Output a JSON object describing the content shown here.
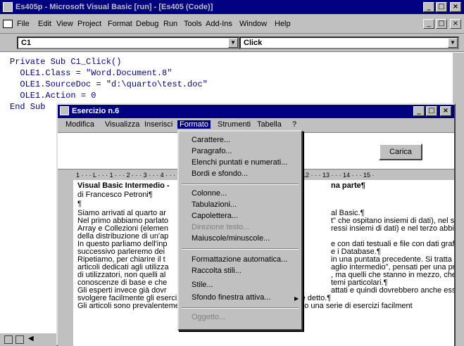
{
  "vb": {
    "title": "Es405p - Microsoft Visual Basic [run] - [Es405 (Code)]",
    "menu": [
      "File",
      "Edit",
      "View",
      "Project",
      "Format",
      "Debug",
      "Run",
      "Tools",
      "Add-Ins",
      "Window",
      "Help"
    ],
    "object_combo": "C1",
    "proc_combo": "Click",
    "code": [
      "Private Sub C1_Click()",
      "  OLE1.Class = \"Word.Document.8\"",
      "  OLE1.SourceDoc = \"d:\\quarto\\test.doc\"",
      "  OLE1.Action = 0",
      "End Sub"
    ]
  },
  "esercizio": {
    "title": "Esercizio n.6",
    "menu": [
      "Modifica",
      "Visualizza",
      "Inserisci",
      "Formato",
      "Strumenti",
      "Tabella",
      "?"
    ],
    "active_menu": "Formato",
    "carica_button": "Carica",
    "ruler": "1 · · · L · · · 1 · · · 2 · · · 3 · · · 4 · · · 5 · · · 6 · · · 7 · · · 8 · · · 9 · · · 10 · · · 11 · · · 12 · · · 13 · · · 14 · · · 15 ·"
  },
  "format_menu": {
    "groups": [
      [
        "Carattere...",
        "Paragrafo...",
        "Elenchi puntati e numerati...",
        "Bordi e sfondo..."
      ],
      [
        "Colonne...",
        "Tabulazioni...",
        "Capolettera...",
        "Direzione testo...",
        "Maiuscole/minuscole..."
      ],
      [
        "Formattazione automatica...",
        "Raccolta stili...",
        "Stile...",
        "Sfondo finestra attiva..."
      ],
      [
        "Oggetto..."
      ]
    ],
    "disabled": [
      "Direzione testo...",
      "Oggetto..."
    ]
  },
  "document": {
    "left_lines": [
      {
        "text": "Visual Basic Intermedio -",
        "bold": true
      },
      {
        "text": "di Francesco Petroni¶",
        "bold": false
      },
      {
        "text": "¶",
        "bold": false
      },
      {
        "text": "Siamo arrivati al quarto ar",
        "bold": false
      },
      {
        "text": "Nel primo abbiamo parlato",
        "bold": false
      },
      {
        "text": "Array e Collezioni (elemen",
        "bold": false
      },
      {
        "text": "della distribuzione di un'ap",
        "bold": false
      },
      {
        "text": "In questo parliamo dell'inp",
        "bold": false
      },
      {
        "text": "successivo parleremo dei",
        "bold": false
      },
      {
        "text": "Ripetiamo, per chiarire il t",
        "bold": false
      },
      {
        "text": "articoli dedicati agli utilizza",
        "bold": false
      },
      {
        "text": "di utilizzatori, non quelli al",
        "bold": false
      },
      {
        "text": "conoscenze di base e che",
        "bold": false
      },
      {
        "text": "Gli esperti invece già dovr",
        "bold": false
      },
      {
        "text": "svolgere facilmente gli esercizi che corredano l'articolo... ma non è detto.¶",
        "bold": false
      },
      {
        "text": "Gli articoli sono prevalentemente pratici, nel senso che propongono una serie di esercizi facilment",
        "bold": false
      }
    ],
    "right_lines": [
      {
        "text": "na parte¶",
        "bold": true
      },
      {
        "text": "",
        "bold": false
      },
      {
        "text": "",
        "bold": false
      },
      {
        "text": "al Basic.¶",
        "bold": false
      },
      {
        "text": "t\" che ospitano insiemi di dati), nel sec",
        "bold": false
      },
      {
        "text": "ressi insiemi di dati) e nel terzo abbiam",
        "bold": false
      },
      {
        "text": "",
        "bold": false
      },
      {
        "text": "e con dati testuali e file con dati grafici",
        "bold": false
      },
      {
        "text": "e i Database.¶",
        "bold": false
      },
      {
        "text": "in una puntata precedente. Si tratta d",
        "bold": false
      },
      {
        "text": "aglio intermedio\", pensati per una preci",
        "bold": false
      },
      {
        "text": ", ma quelli che stanno in mezzo, che ha",
        "bold": false
      },
      {
        "text": "temi particolari.¶",
        "bold": false
      },
      {
        "text": "attati e quindi dovrebbero anche esser",
        "bold": false
      }
    ]
  }
}
